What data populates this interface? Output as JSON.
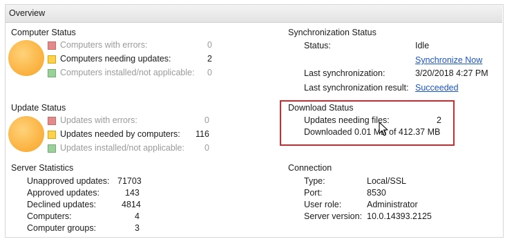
{
  "header": {
    "title": "Overview"
  },
  "computer_status": {
    "title": "Computer Status",
    "rows": [
      {
        "label": "Computers with errors:",
        "value": "0"
      },
      {
        "label": "Computers needing updates:",
        "value": "2"
      },
      {
        "label": "Computers installed/not applicable:",
        "value": "0"
      }
    ]
  },
  "update_status": {
    "title": "Update Status",
    "rows": [
      {
        "label": "Updates with errors:",
        "value": "0"
      },
      {
        "label": "Updates needed by computers:",
        "value": "116"
      },
      {
        "label": "Updates installed/not applicable:",
        "value": "0"
      }
    ]
  },
  "server_statistics": {
    "title": "Server Statistics",
    "rows": [
      {
        "label": "Unapproved updates:",
        "value": "71703"
      },
      {
        "label": "Approved updates:",
        "value": "143"
      },
      {
        "label": "Declined updates:",
        "value": "4814"
      },
      {
        "label": "Computers:",
        "value": "4"
      },
      {
        "label": "Computer groups:",
        "value": "3"
      }
    ]
  },
  "sync_status": {
    "title": "Synchronization Status",
    "status_label": "Status:",
    "status_value": "Idle",
    "sync_now": "Synchronize Now",
    "last_sync_label": "Last synchronization:",
    "last_sync_value": "3/20/2018 4:27 PM",
    "last_result_label": "Last synchronization result:",
    "last_result_value": "Succeeded"
  },
  "download_status": {
    "title": "Download Status",
    "files_label": "Updates needing files:",
    "files_value": "2",
    "downloaded_text": "Downloaded 0.01 MB of 412.37 MB"
  },
  "connection": {
    "title": "Connection",
    "rows": [
      {
        "label": "Type:",
        "value": "Local/SSL"
      },
      {
        "label": "Port:",
        "value": "8530"
      },
      {
        "label": "User role:",
        "value": "Administrator"
      },
      {
        "label": "Server version:",
        "value": "10.0.14393.2125"
      }
    ]
  },
  "colors": {
    "link": "#1a55c8",
    "highlight": "#d9262b",
    "status_circle": "#fbb545"
  }
}
